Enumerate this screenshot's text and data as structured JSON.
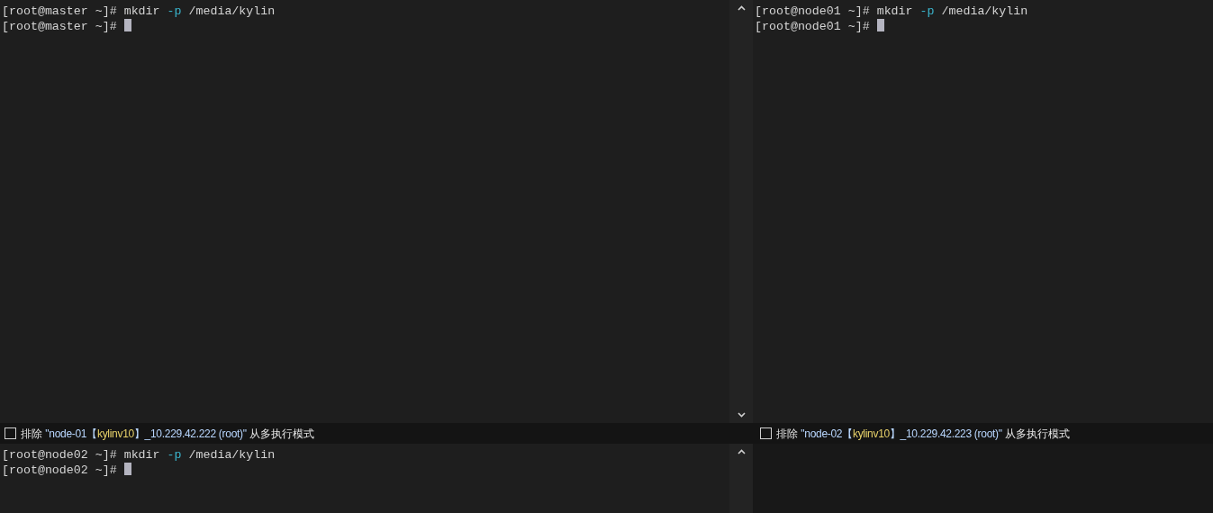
{
  "panes": [
    {
      "scrollbar": true,
      "lines": [
        {
          "cursor": false,
          "segments": [
            {
              "kind": "plain",
              "text": "[root@master ~]# mkdir "
            },
            {
              "kind": "option",
              "text": "-p"
            },
            {
              "kind": "plain",
              "text": " /media/kylin"
            }
          ]
        },
        {
          "cursor": true,
          "segments": [
            {
              "kind": "plain",
              "text": "[root@master ~]# "
            }
          ]
        }
      ],
      "exclude_bar": {
        "checked": false,
        "prefix": "排除",
        "quote_before": "\"node-01【",
        "highlight": "kylinv10",
        "quote_after": "】_10.229.42.222 (root)\"",
        "suffix": "从多执行模式"
      }
    },
    {
      "scrollbar": false,
      "lines": [
        {
          "cursor": false,
          "segments": [
            {
              "kind": "plain",
              "text": "[root@node01 ~]# mkdir "
            },
            {
              "kind": "option",
              "text": "-p"
            },
            {
              "kind": "plain",
              "text": " /media/kylin"
            }
          ]
        },
        {
          "cursor": true,
          "segments": [
            {
              "kind": "plain",
              "text": "[root@node01 ~]# "
            }
          ]
        }
      ],
      "exclude_bar": {
        "checked": false,
        "prefix": "排除",
        "quote_before": "\"node-02【",
        "highlight": "kylinv10",
        "quote_after": "】_10.229.42.223 (root)\"",
        "suffix": "从多执行模式"
      }
    },
    {
      "scrollbar": true,
      "lines": [
        {
          "cursor": false,
          "segments": [
            {
              "kind": "plain",
              "text": "[root@node02 ~]# mkdir "
            },
            {
              "kind": "option",
              "text": "-p"
            },
            {
              "kind": "plain",
              "text": " /media/kylin"
            }
          ]
        },
        {
          "cursor": true,
          "segments": [
            {
              "kind": "plain",
              "text": "[root@node02 ~]# "
            }
          ]
        }
      ]
    },
    {
      "scrollbar": false
    }
  ]
}
